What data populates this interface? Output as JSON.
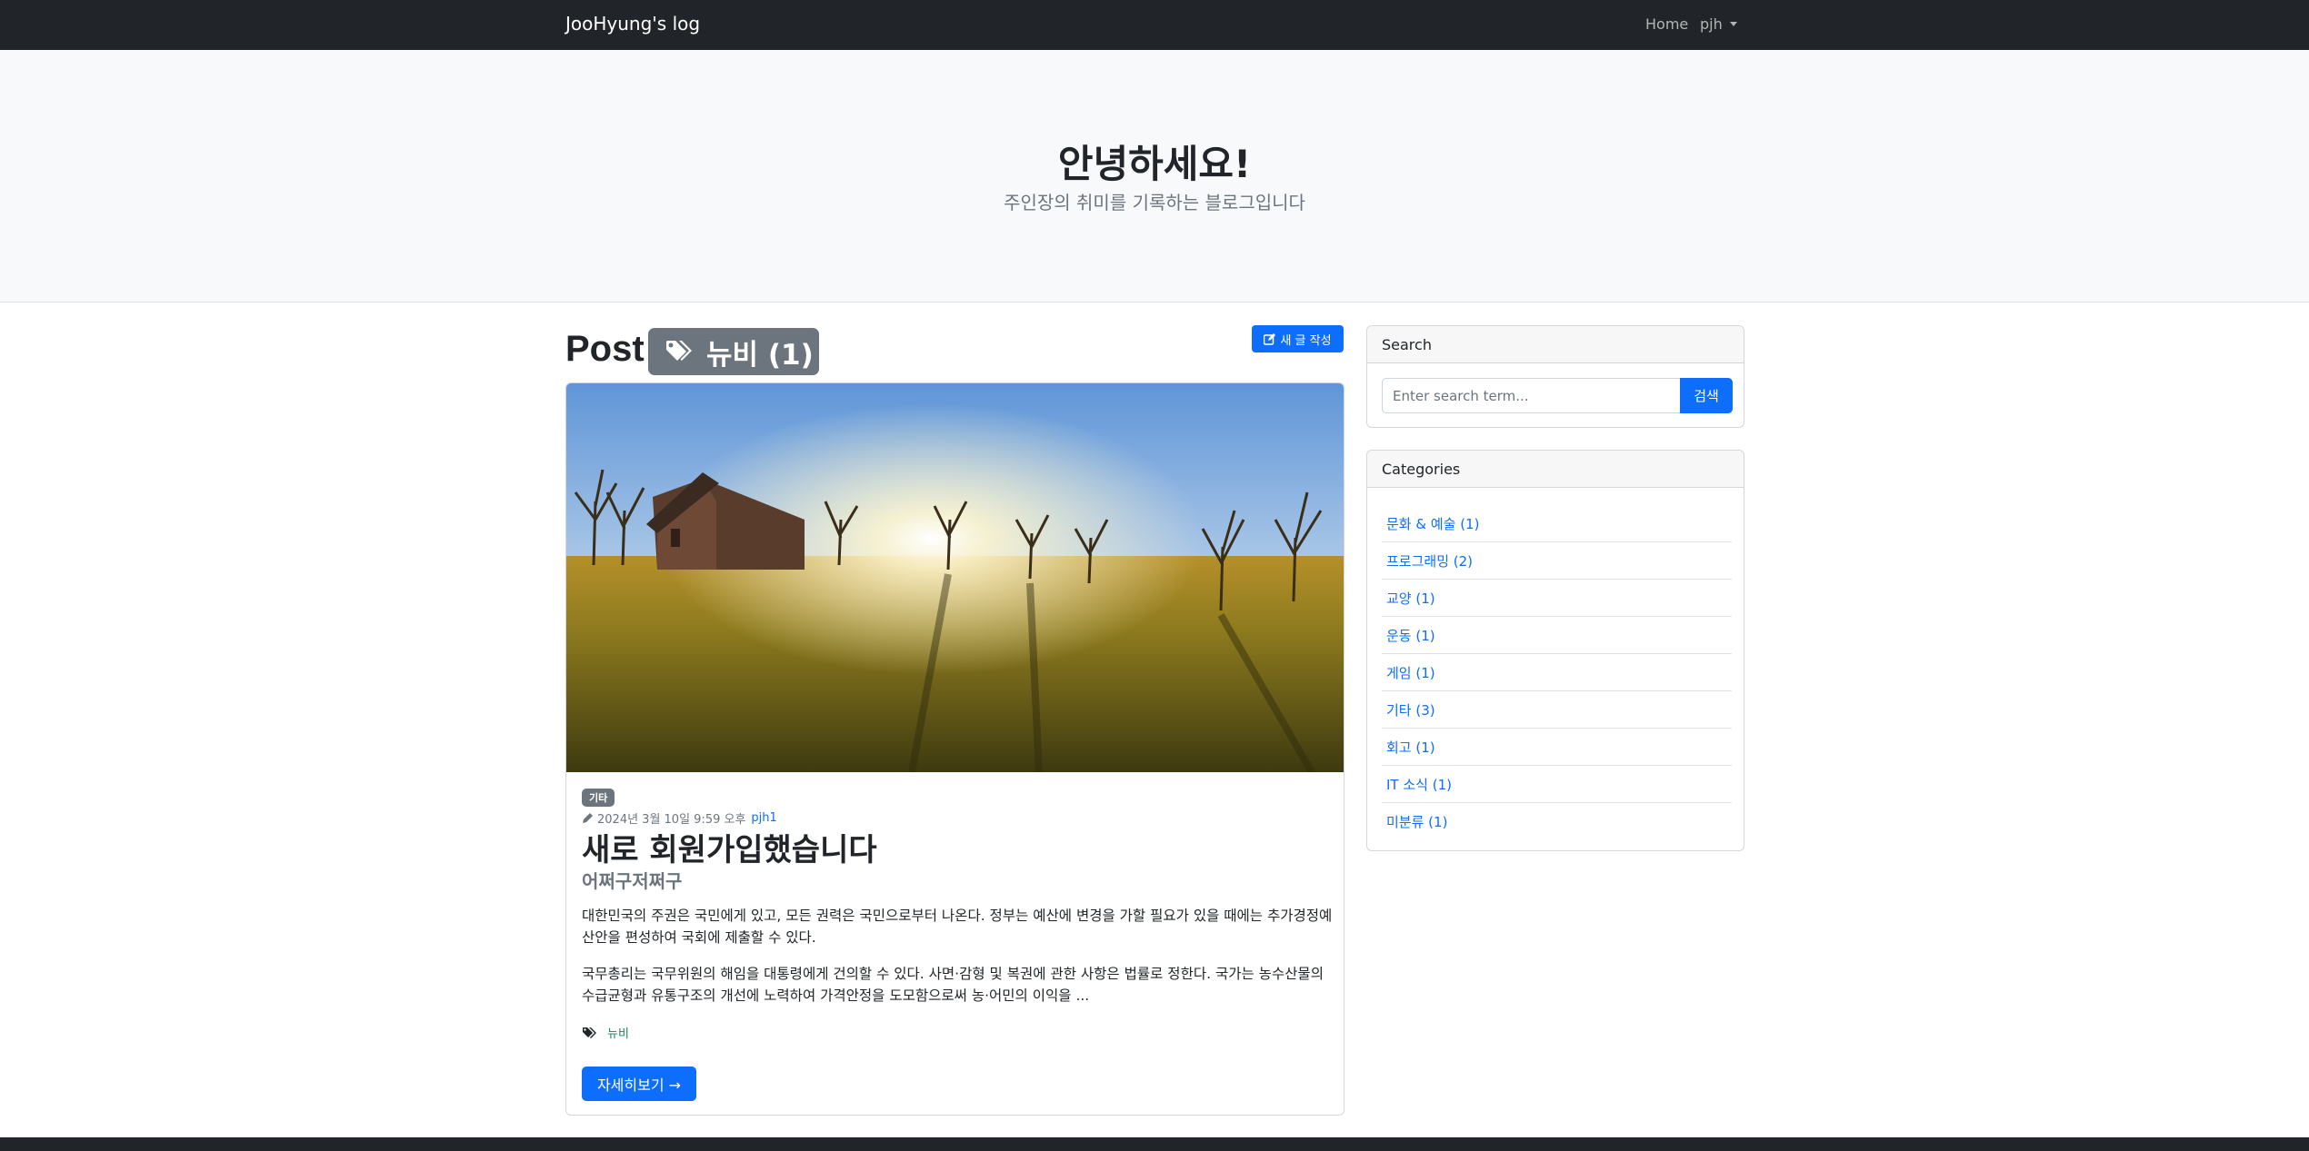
{
  "navbar": {
    "brand": "JooHyung's log",
    "links": {
      "home": "Home",
      "user": "pjh"
    }
  },
  "hero": {
    "title": "안녕하세요!",
    "subtitle": "주인장의 취미를 기록하는 블로그입니다"
  },
  "post_header": {
    "heading": "Post",
    "tag_badge": "뉴비 (1)",
    "new_post_button": "새 글 작성"
  },
  "post": {
    "image_description": "sunlit field with barn and bare trees",
    "category": "기타",
    "date": "2024년 3월 10일 9:59 오후",
    "author": "pjh1",
    "title": "새로 회원가입했습니다",
    "subtitle": "어쩌구저쩌구",
    "paragraph1": "대한민국의 주권은 국민에게 있고, 모든 권력은 국민으로부터 나온다. 정부는 예산에 변경을 가할 필요가 있을 때에는 추가경정예산안을 편성하여 국회에 제출할 수 있다.",
    "paragraph2": "국무총리는 국무위원의 해임을 대통령에게 건의할 수 있다. 사면·감형 및 복권에 관한 사항은 법률로 정한다. 국가는 농수산물의 수급균형과 유통구조의 개선에 노력하여 가격안정을 도모함으로써 농·어민의 이익을 ...",
    "tags": [
      "뉴비"
    ],
    "read_more": "자세히보기 →"
  },
  "sidebar": {
    "search": {
      "header": "Search",
      "placeholder": "Enter search term...",
      "button": "검색"
    },
    "categories": {
      "header": "Categories",
      "items": [
        {
          "label": "문화 & 예술 (1)"
        },
        {
          "label": "프로그래밍 (2)"
        },
        {
          "label": "교양 (1)"
        },
        {
          "label": "운동 (1)"
        },
        {
          "label": "게임 (1)"
        },
        {
          "label": "기타 (3)"
        },
        {
          "label": "회고 (1)"
        },
        {
          "label": "IT 소식 (1)"
        },
        {
          "label": "미분류 (1)"
        }
      ]
    }
  },
  "colors": {
    "navbar_bg": "#212529",
    "hero_bg": "#f8f9fa",
    "primary": "#0d6efd",
    "secondary": "#6c757d",
    "tag_green": "#198754"
  }
}
